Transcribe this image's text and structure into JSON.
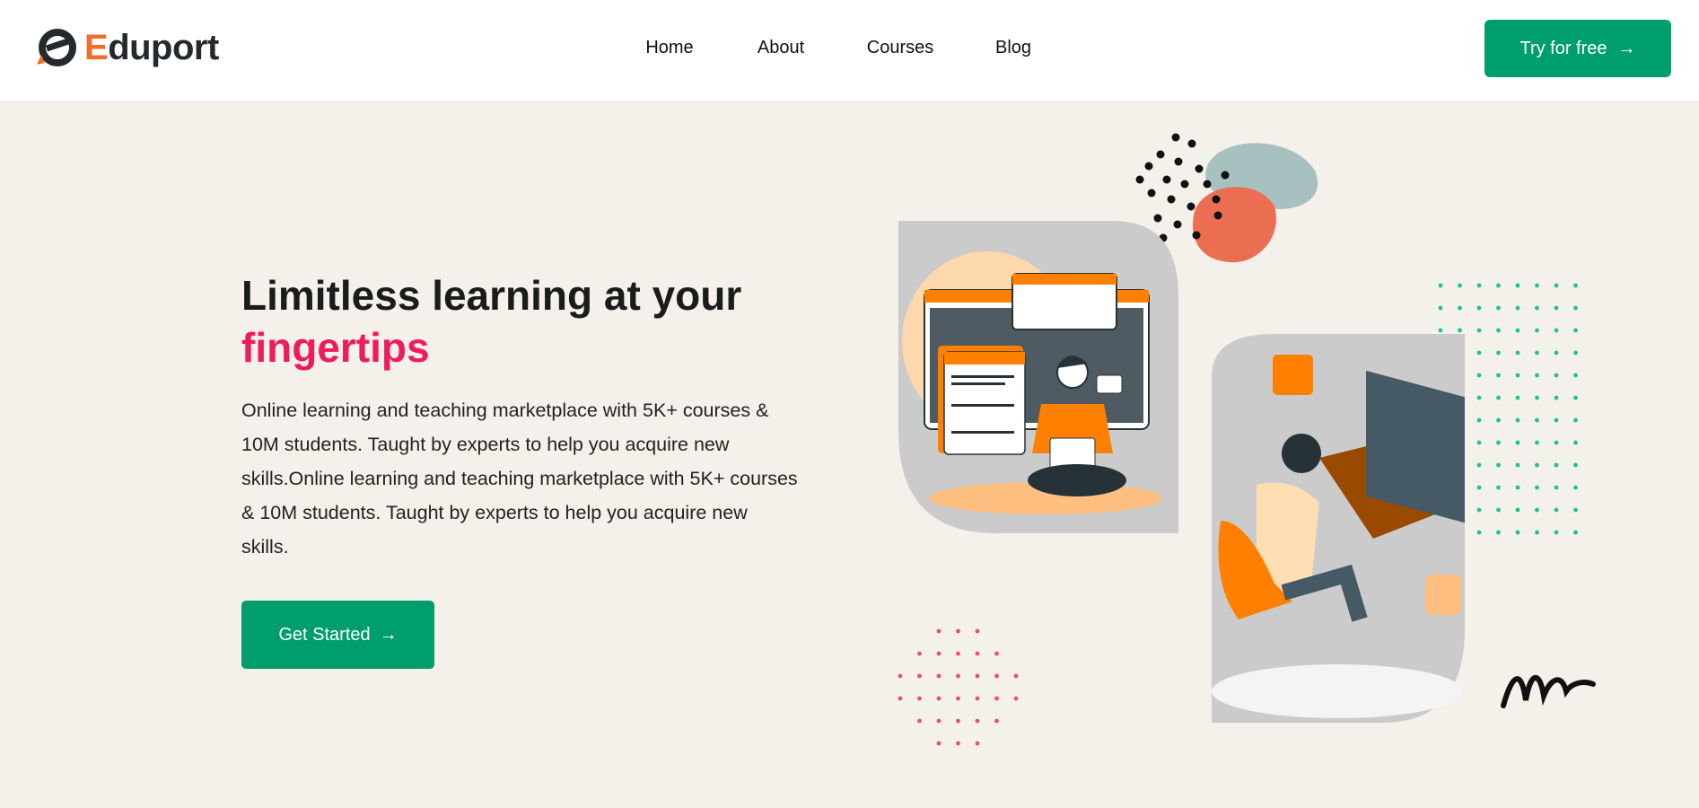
{
  "header": {
    "logo": {
      "letter": "E",
      "rest": "duport"
    },
    "nav": [
      {
        "label": "Home"
      },
      {
        "label": "About"
      },
      {
        "label": "Courses"
      },
      {
        "label": "Blog"
      }
    ],
    "cta_label": "Try for free"
  },
  "hero": {
    "title_line1": "Limitless learning at your",
    "title_highlight": "fingertips",
    "description": "Online learning and teaching marketplace with 5K+ courses & 10M students. Taught by experts to help you acquire new skills.Online learning and teaching marketplace with 5K+ courses & 10M students. Taught by experts to help you acquire new skills.",
    "button_label": "Get Started"
  },
  "colors": {
    "brand_green": "#009e6c",
    "accent_pink": "#ee1c5c",
    "logo_orange": "#f26c2a",
    "illustration_orange": "#ff8000"
  },
  "icons": {
    "arrow": "arrow-right-icon"
  }
}
